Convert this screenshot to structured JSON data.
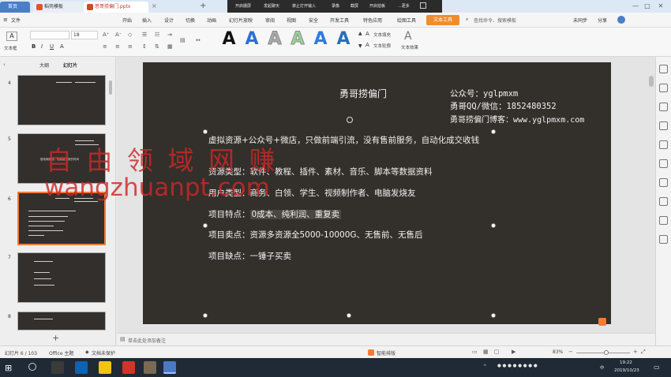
{
  "titlebar": {
    "tabs": [
      "首页",
      "稻壳模板",
      "思哥捞偏门.pptx"
    ],
    "controls": [
      "—",
      "□",
      "✕"
    ]
  },
  "recording_bar": {
    "items": [
      "开启摄屏",
      "发起聊天",
      "禁止打开输入",
      "录像",
      "截屏",
      "开启拍板",
      "...更多"
    ]
  },
  "menu": {
    "items": [
      "文件",
      "开始",
      "插入",
      "设计",
      "切换",
      "动画",
      "幻灯片放映",
      "审阅",
      "视图",
      "安全",
      "开发工具",
      "特色应用",
      "绘图工具"
    ],
    "active": "文本工具",
    "search": "查找命令、搜索模板",
    "right_items": [
      "未同步",
      "分享"
    ]
  },
  "ribbon": {
    "font_size": "18",
    "text_box_label": "文本框",
    "style_letters": [
      "A",
      "A",
      "A",
      "A",
      "A",
      "A"
    ],
    "style_colors": [
      "#111111",
      "#2d6fd6",
      "#aaaaaa",
      "#9bd39b",
      "#2c7be5",
      "#2c6fb8"
    ],
    "text_fill": "文本填充",
    "text_outline": "文本轮廓",
    "text_effect": "文本效果"
  },
  "left_panel": {
    "tabs": [
      "大纲",
      "幻灯片"
    ],
    "slides": [
      {
        "num": "4",
        "caption": ""
      },
      {
        "num": "5",
        "caption": "做电商赚钱，别浪费宝贵的时间"
      },
      {
        "num": "6",
        "caption": ""
      },
      {
        "num": "7",
        "caption": ""
      },
      {
        "num": "8",
        "caption": ""
      }
    ],
    "add_label": "+"
  },
  "slide": {
    "title": "勇哥捞偏门",
    "contact": {
      "line1": "公众号：yglpmxm",
      "line2": "勇哥QQ/微信：1852480352",
      "line3": "勇哥捞偏门博客：www.yglpmxm.com"
    },
    "bullets": [
      "虚拟资源+公众号+微店，只做前端引流，没有售前服务，自动化成交收钱",
      "资源类型：软件、教程、插件、素材、音乐、脚本等数据资料",
      "用户类型：商务、白领、学生、视频制作者、电脑发烧友",
      "项目特点：0成本、纯利润、重复卖",
      "项目卖点：资源多资源全5000-10000G、无售前、无售后",
      "项目缺点：一锤子买卖"
    ],
    "highlight_label": "项目特点：",
    "highlight_value": "0成本、纯利润、重复卖"
  },
  "watermark": {
    "line1": "自 由 领 域 网 赚",
    "line2": "wangzhuanpt.com"
  },
  "notes": {
    "placeholder": "单击此处添加备注"
  },
  "status": {
    "slide_counter": "幻灯片 6 / 103",
    "theme": "Office 主题",
    "protect": "文档未保护",
    "smart": "智能排版",
    "zoom": "83%"
  },
  "taskbar": {
    "time": "19:22",
    "date": "2019/10/23"
  },
  "colors": {
    "accent": "#f08c2e",
    "slide_bg": "#332f2b",
    "watermark": "#cc2828"
  }
}
